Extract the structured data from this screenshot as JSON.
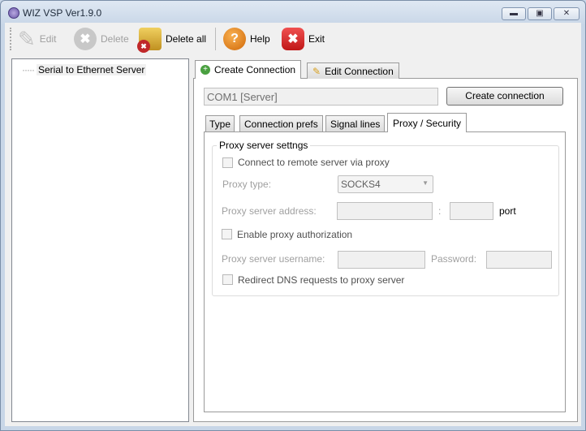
{
  "window": {
    "title": "WIZ VSP Ver1.9.0",
    "controls": [
      "minimize",
      "maximize",
      "close"
    ]
  },
  "toolbar": {
    "edit": "Edit",
    "delete": "Delete",
    "delete_all": "Delete all",
    "help": "Help",
    "exit": "Exit"
  },
  "tree": {
    "items": [
      "Serial to Ethernet Server"
    ]
  },
  "main_tabs": {
    "create": "Create Connection",
    "edit": "Edit Connection"
  },
  "port_field": {
    "value": "COM1 [Server]"
  },
  "create_button": "Create connection",
  "sub_tabs": [
    "Type",
    "Connection prefs",
    "Signal lines",
    "Proxy / Security"
  ],
  "proxy": {
    "group_title": "Proxy server settngs",
    "connect_via_proxy": {
      "label": "Connect to remote server via proxy",
      "checked": false
    },
    "proxy_type_label": "Proxy type:",
    "proxy_type_value": "SOCKS4",
    "address_label": "Proxy server address:",
    "address_value": "",
    "colon": ":",
    "port_value": "",
    "port_label": "port",
    "enable_auth": {
      "label": "Enable proxy authorization",
      "checked": false
    },
    "username_label": "Proxy server username:",
    "username_value": "",
    "password_label": "Password:",
    "password_value": "",
    "redirect_dns": {
      "label": "Redirect DNS requests to proxy server",
      "checked": false
    }
  }
}
